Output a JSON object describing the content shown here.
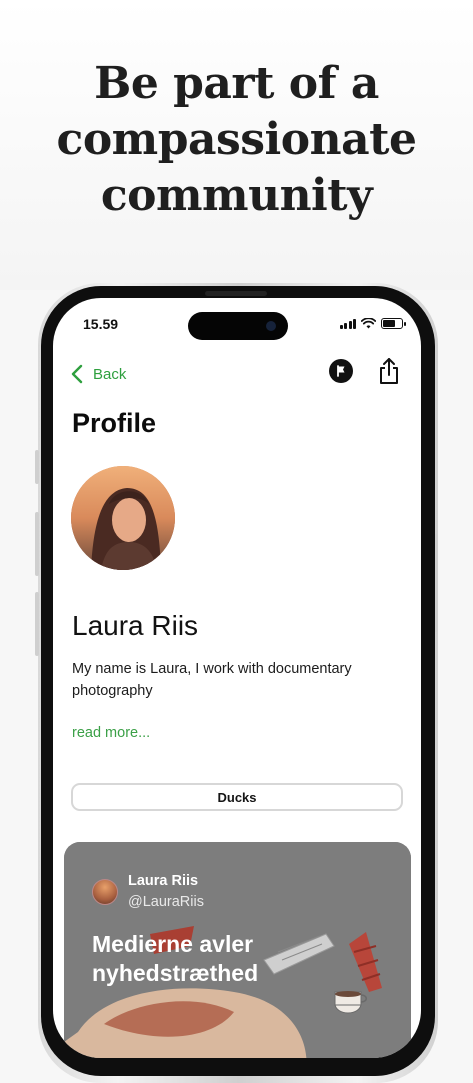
{
  "hero": {
    "line1": "Be part of a",
    "line2": "compassionate",
    "line3": "community"
  },
  "status_bar": {
    "time": "15.59"
  },
  "nav": {
    "back_label": "Back",
    "flag_icon": "flag-icon",
    "share_icon": "share-icon",
    "back_icon": "chevron-left-icon"
  },
  "profile": {
    "page_title": "Profile",
    "name": "Laura Riis",
    "bio": "My name is Laura, I work with documentary photography",
    "read_more": "read more...",
    "tag": "Ducks"
  },
  "post": {
    "author": "Laura Riis",
    "handle": "@LauraRiis",
    "title": "Medierne avler nyhedstræthed"
  },
  "colors": {
    "accent_green": "#2e9f3e",
    "card_gray": "#7c7c7c"
  }
}
